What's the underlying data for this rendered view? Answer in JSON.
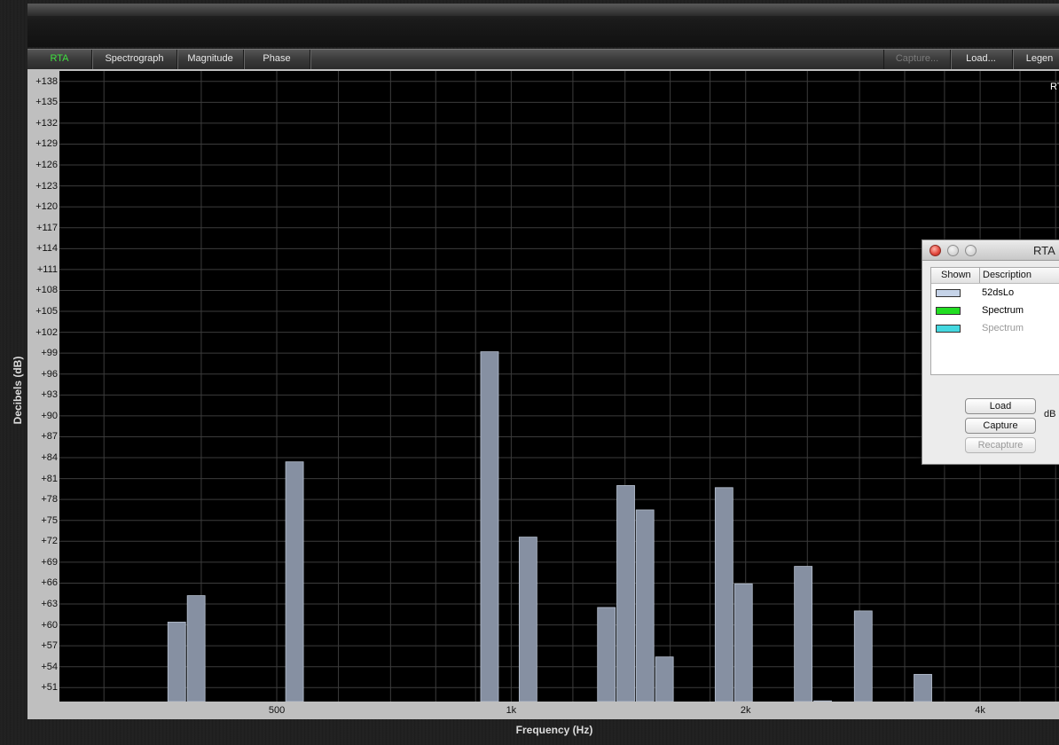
{
  "toolbar": {
    "tabs": [
      {
        "label": "RTA",
        "active": true
      },
      {
        "label": "Spectrograph"
      },
      {
        "label": "Magnitude"
      },
      {
        "label": "Phase"
      }
    ],
    "capture_label": "Capture...",
    "load_label": "Load...",
    "legend_label": "Legen"
  },
  "plot": {
    "corner_label": "RT"
  },
  "chart_data": {
    "type": "bar",
    "xlabel": "Frequency (Hz)",
    "ylabel": "Decibels (dB)",
    "x_scale": "log",
    "xlim_hz": [
      263,
      5050
    ],
    "ylim": [
      49,
      139.5
    ],
    "y_ticks": [
      "+138",
      "+135",
      "+132",
      "+129",
      "+126",
      "+123",
      "+120",
      "+117",
      "+114",
      "+111",
      "+108",
      "+105",
      "+102",
      "+99",
      "+96",
      "+93",
      "+90",
      "+87",
      "+84",
      "+81",
      "+78",
      "+75",
      "+72",
      "+69",
      "+66",
      "+63",
      "+60",
      "+57",
      "+54",
      "+51"
    ],
    "x_tick_labels": [
      {
        "label": "500",
        "hz": 500
      },
      {
        "label": "1k",
        "hz": 1000
      },
      {
        "label": "2k",
        "hz": 2000
      },
      {
        "label": "4k",
        "hz": 4000
      }
    ],
    "grid": true,
    "bar_color": "#8690a2",
    "series": [
      {
        "name": "52dsLo",
        "bars": [
          {
            "freq": 372,
            "db": 60.4
          },
          {
            "freq": 394,
            "db": 64.2
          },
          {
            "freq": 527,
            "db": 83.4
          },
          {
            "freq": 938,
            "db": 99.2
          },
          {
            "freq": 1051,
            "db": 72.6
          },
          {
            "freq": 1325,
            "db": 62.5
          },
          {
            "freq": 1403,
            "db": 80.0
          },
          {
            "freq": 1485,
            "db": 76.5
          },
          {
            "freq": 1573,
            "db": 55.4
          },
          {
            "freq": 1876,
            "db": 79.7
          },
          {
            "freq": 1987,
            "db": 65.9
          },
          {
            "freq": 2371,
            "db": 68.4
          },
          {
            "freq": 2511,
            "db": 49.1
          },
          {
            "freq": 2831,
            "db": 62.0
          },
          {
            "freq": 3377,
            "db": 52.9
          }
        ]
      }
    ]
  },
  "legend_window": {
    "title": "RTA",
    "col_shown": "Shown",
    "col_description": "Description",
    "rows": [
      {
        "description": "52dsLo",
        "color": "#c5d3e8",
        "enabled": true
      },
      {
        "description": "Spectrum",
        "color": "#22dd22",
        "enabled": true
      },
      {
        "description": "Spectrum",
        "color": "#44d8e0",
        "enabled": false
      }
    ],
    "load_button": "Load",
    "capture_button": "Capture",
    "recapture_button": "Recapture",
    "db_label": "dB"
  }
}
